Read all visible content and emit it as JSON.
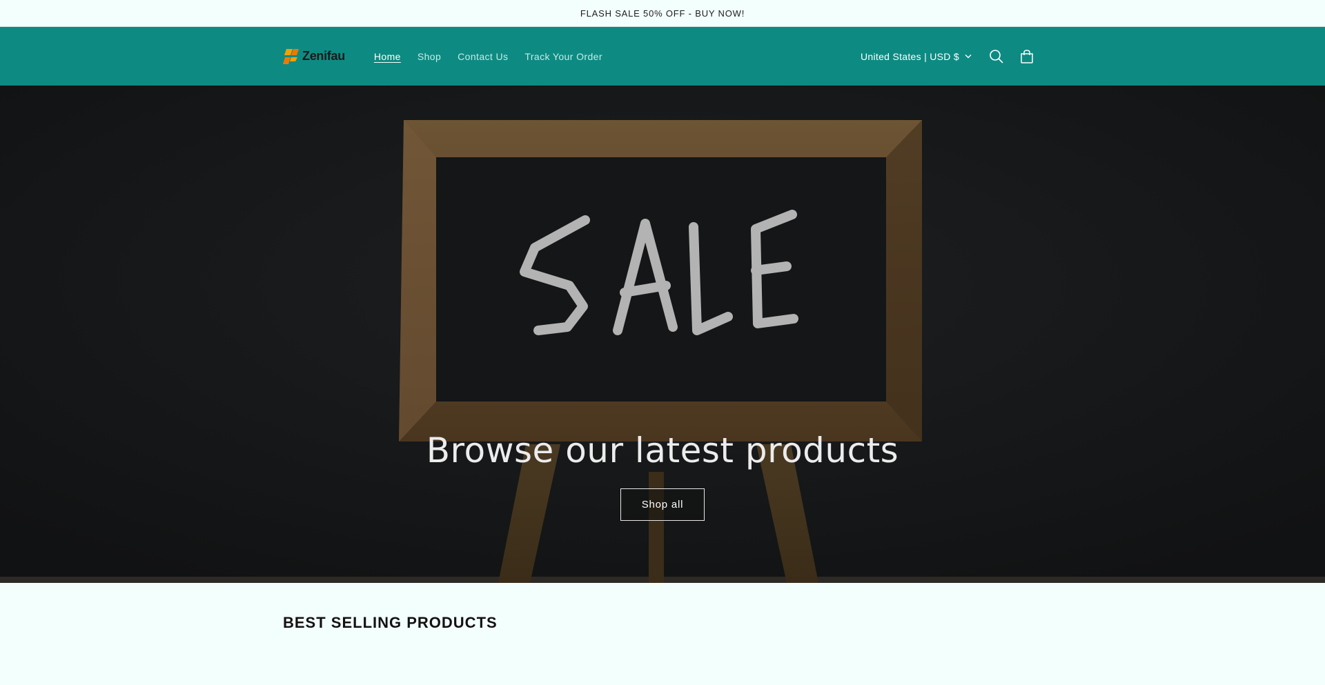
{
  "announcement": {
    "text": "FLASH SALE 50% OFF - BUY NOW!"
  },
  "header": {
    "logo_text": "Zenifau",
    "nav": [
      {
        "label": "Home",
        "active": true
      },
      {
        "label": "Shop",
        "active": false
      },
      {
        "label": "Contact Us",
        "active": false
      },
      {
        "label": "Track Your Order",
        "active": false
      }
    ],
    "country_selector": "United States | USD $",
    "icons": [
      "search-icon",
      "cart-icon",
      "chevron-down-icon"
    ],
    "background_color": "#0d8b82"
  },
  "hero": {
    "image_alt": "SALE chalkboard on wooden easel",
    "chalk_text": "SALE",
    "title": "Browse our latest products",
    "button_label": "Shop all"
  },
  "best_selling": {
    "title": "BEST SELLING PRODUCTS"
  }
}
